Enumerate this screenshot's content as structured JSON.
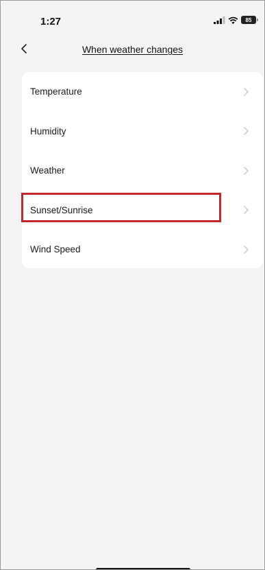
{
  "status_bar": {
    "time": "1:27",
    "battery": "85"
  },
  "header": {
    "title": "When weather changes",
    "back_icon": "chevron-left-icon"
  },
  "conditions": {
    "items": [
      {
        "label": "Temperature"
      },
      {
        "label": "Humidity"
      },
      {
        "label": "Weather"
      },
      {
        "label": "Sunset/Sunrise"
      },
      {
        "label": "Wind Speed"
      }
    ],
    "highlighted_index": 3,
    "chevron_icon": "chevron-right-icon"
  },
  "colors": {
    "background": "#f4f4f6",
    "card": "#ffffff",
    "highlight": "#c1272d",
    "chevron": "#c4c4c8"
  }
}
